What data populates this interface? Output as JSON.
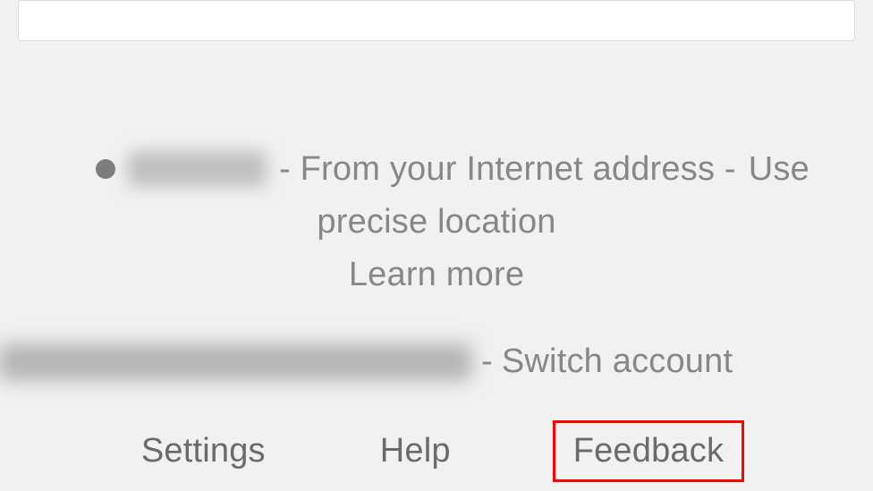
{
  "card": {
    "truncated_text": ""
  },
  "location": {
    "prefix": "- From your Internet address -",
    "use_precise": "Use",
    "precise_location": "precise location",
    "learn_more": "Learn more"
  },
  "account": {
    "separator": "-",
    "switch_label": "Switch account"
  },
  "footer": {
    "settings": "Settings",
    "help": "Help",
    "feedback": "Feedback"
  }
}
